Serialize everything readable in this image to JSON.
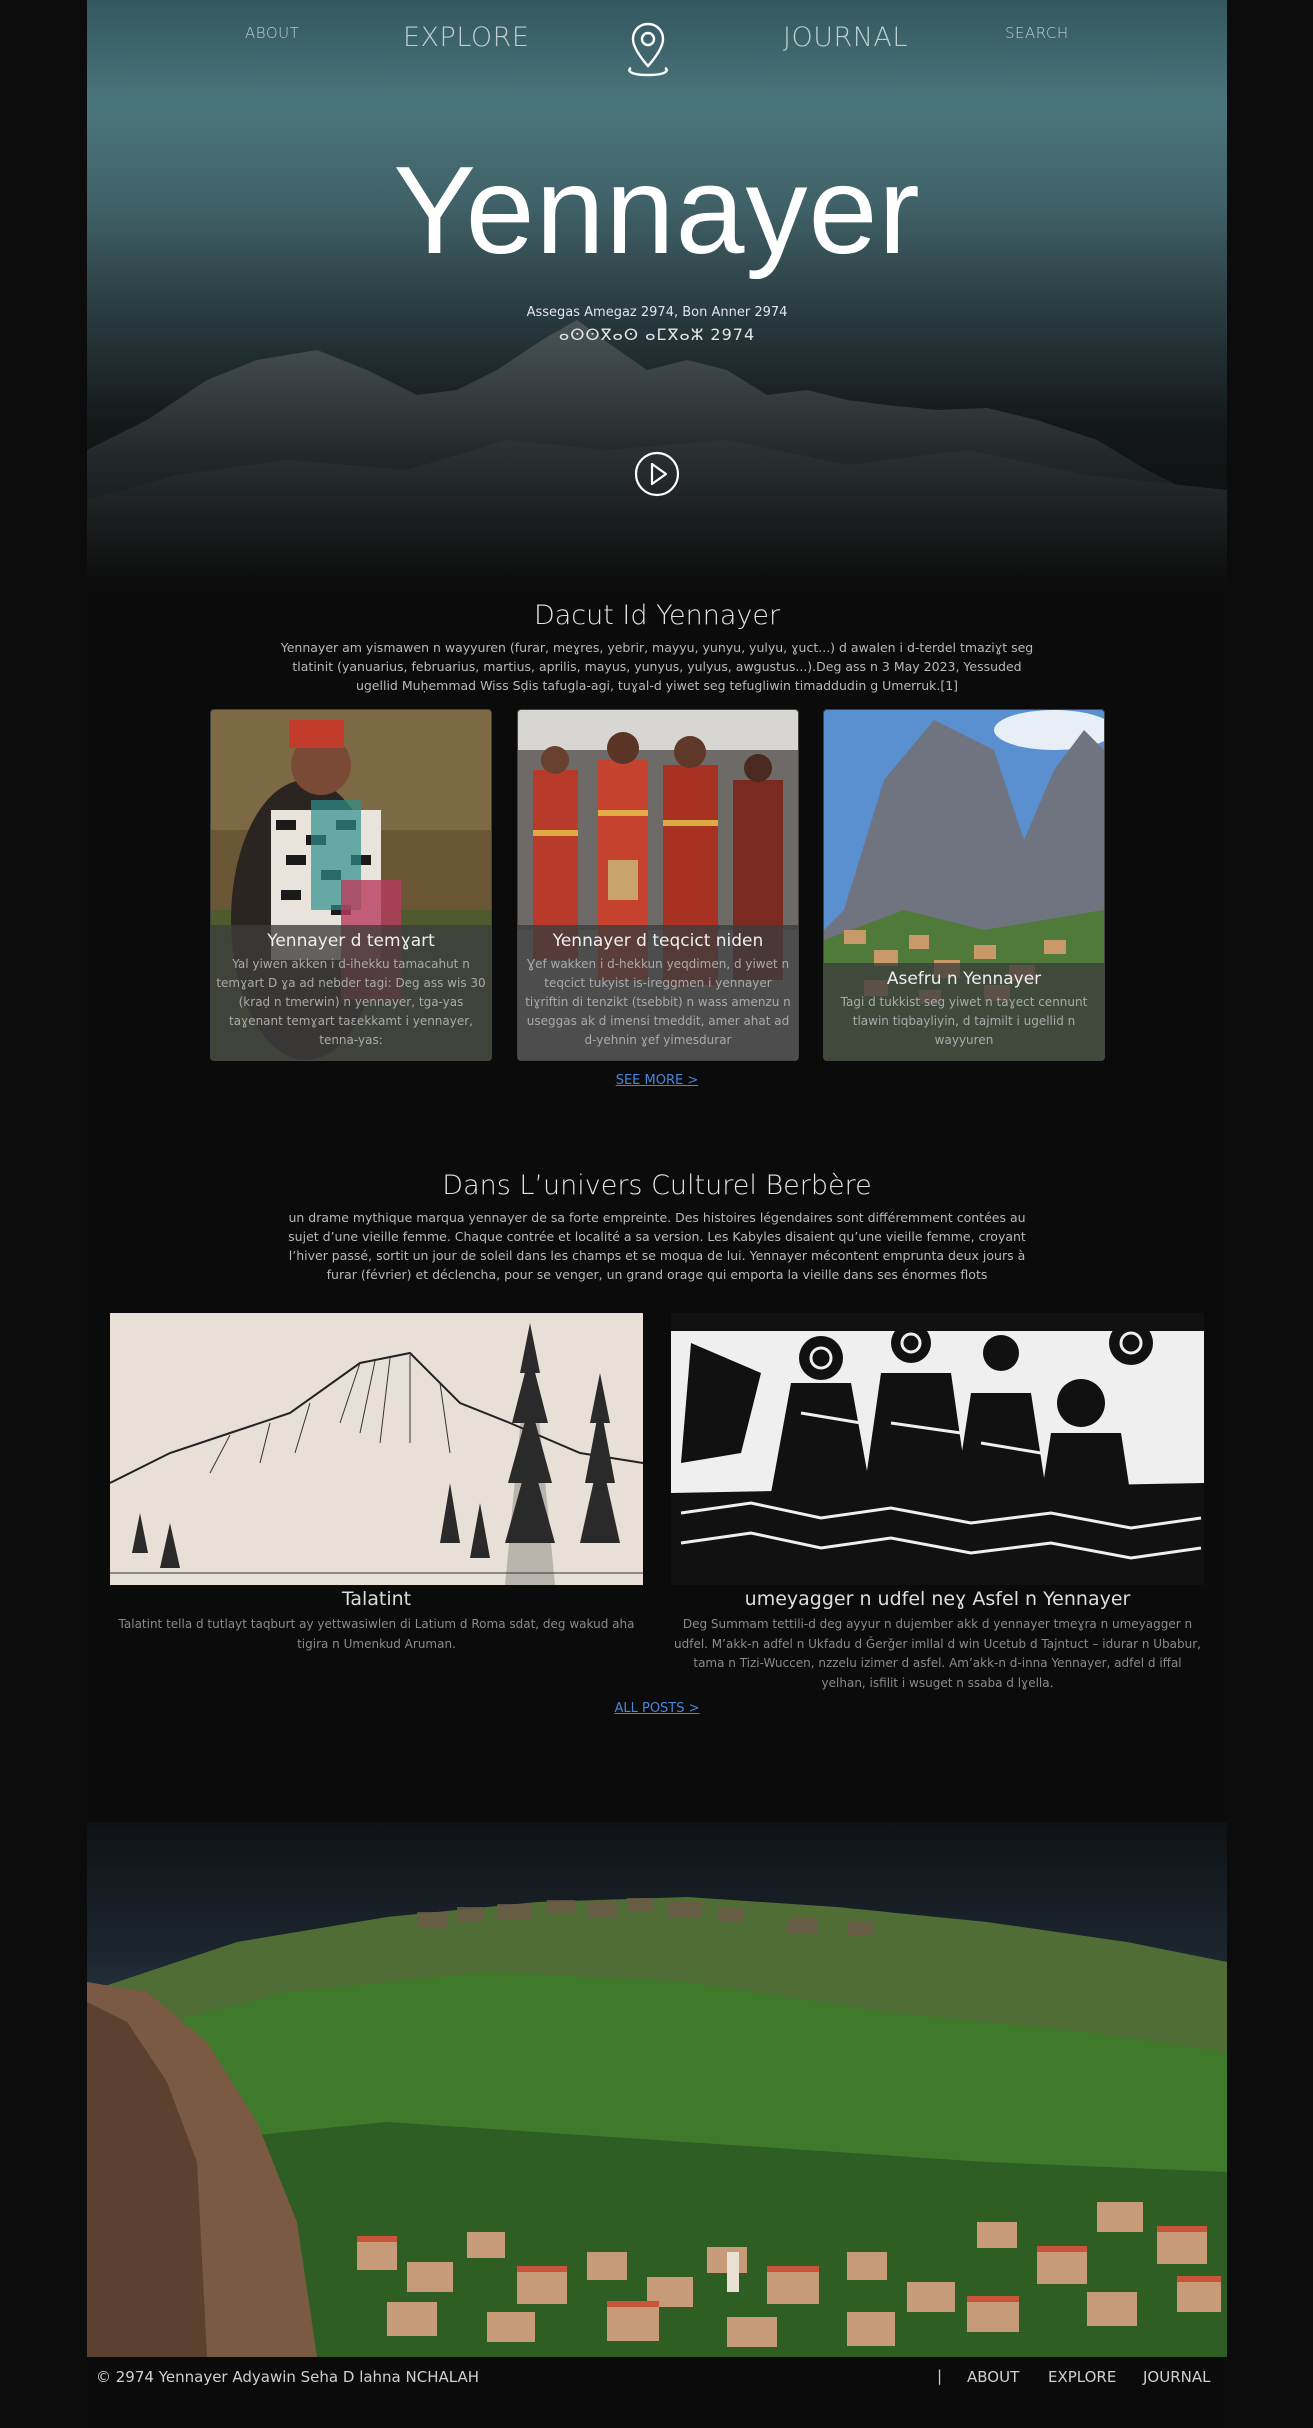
{
  "nav": {
    "about": "ABOUT",
    "explore": "EXPLORE",
    "journal": "JOURNAL",
    "search": "SEARCH",
    "logo_icon": "map-pin-icon"
  },
  "hero": {
    "title": "Yennayer",
    "subtitle_latin": "Assegas Amegaz 2974, Bon Anner 2974",
    "subtitle_tifinagh": "ⴰⵙⵙⴳⴰⵙ ⴰⵎⴳⴰⵣ 2974",
    "play_icon": "play-icon"
  },
  "section1": {
    "title": "Dacut Id Yennayer",
    "text": "Yennayer am yismawen n wayyuren (furar, meɣres, yebrir, mayyu, yunyu, yulyu, ɣuct...) d awalen i d-terdel tmaziɣt seg tlatinit (yanuarius, februarius, martius, aprilis, mayus, yunyus, yulyus, awgustus...).Deg ass n 3 May 2023, Yessuded ugellid Muḥemmad Wiss Sḍis tafugla-agi, tuɣal-d yiwet seg tefugliwin timaddudin g Umerruk.[1]",
    "cards": [
      {
        "title": "Yennayer d temɣart",
        "text": "Yal yiwen akken i d-ihekku tamacahut n temɣart D ɣa ad nebder tagi: Deg ass wis 30 (kraḍ n tmerwin) n yennayer, tga-yas taɣenant temɣart taɛekkamt i yennayer, tenna-yas:"
      },
      {
        "title": "Yennayer d teqcict niden",
        "text": "Ɣef wakken i d-hekkun yeqdimen, d yiwet n teqcict tukyist is-ireggmen i yennayer tiɣriftin di tenzikt (tsebbit) n wass amenzu n useggas ak d imensi tmeddit, amer ahat ad d-yehnin ɣef yimesdurar"
      },
      {
        "title": "Asefru n Yennayer",
        "text": "Tagi d tukkist seg yiwet n taɣect cennunt tlawin tiqbayliyin, d tajmilt i ugellid n wayyuren"
      }
    ],
    "see_more": "SEE MORE >"
  },
  "section2": {
    "title": "Dans L’univers Culturel Berbère",
    "text": "un drame mythique marqua yennayer de sa forte empreinte. Des histoires légendaires sont différemment contées au sujet d’une vieille femme. Chaque contrée et localité a sa version. Les Kabyles disaient qu’une vieille femme, croyant l’hiver passé, sortit un jour de soleil dans les champs et se moqua de lui. Yennayer mécontent emprunta deux jours à furar (février) et déclencha, pour se venger, un grand orage qui emporta la vieille dans ses énormes flots",
    "posts": [
      {
        "title": "Talatint",
        "text": "Talatint tella d tutlayt taqburt ay yettwasiwlen di Latium d Roma sdat, deg wakud aha tigira n Umenkud Aruman."
      },
      {
        "title": "umeyagger n udfel neɣ Asfel n Yennayer",
        "text": "Deg Summam tettili-d deg ayyur n dujember akk d yennayer tmeɣra n umeyagger n udfel. M’akk-n adfel n Ukfadu d Ǧerǧer imllal d win Ucetub d Tajntuct – idurar n Ubabur, tama n Tizi-Wuccen, nzzelu izimer d asfel. Am’akk-n d-inna Yennayer, adfel d iffal yelhan, isfilit i wsuget n ssaba d lɣella."
      }
    ],
    "all_posts": "ALL POSTS >"
  },
  "footer": {
    "copyright": "© 2974 Yennayer Adyawin Seha D lahna NCHALAH",
    "separator": "|",
    "links": [
      "ABOUT",
      "EXPLORE",
      "JOURNAL"
    ]
  },
  "colors": {
    "background": "#0b0b0b",
    "link": "#4a86d8",
    "hero_sky": "#4b757c"
  }
}
